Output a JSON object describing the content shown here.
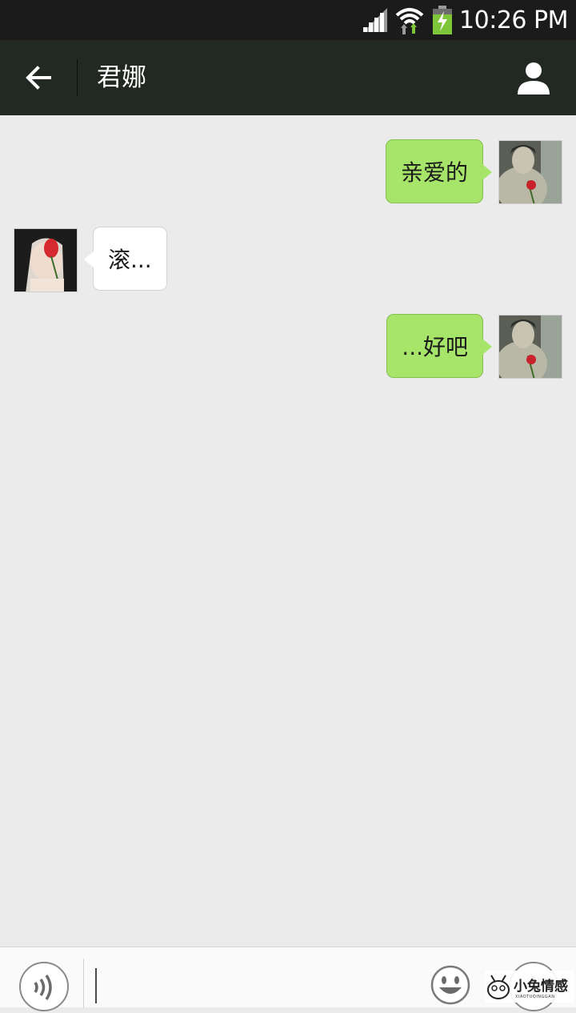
{
  "status_bar": {
    "time": "10:26 PM"
  },
  "header": {
    "title": "君娜"
  },
  "messages": [
    {
      "from": "me",
      "text": "亲爱的"
    },
    {
      "from": "other",
      "text": "滚..."
    },
    {
      "from": "me",
      "text": "...好吧"
    }
  ],
  "watermark": {
    "text": "小兔情感",
    "subtext": "XIAOTUQINGGAN"
  },
  "colors": {
    "status_bar": "#1b1b1b",
    "title_bar": "#212922",
    "background": "#ebebeb",
    "my_bubble": "#a7e46a",
    "other_bubble": "#ffffff"
  },
  "icons": {
    "back": "arrow-left-icon",
    "profile": "person-icon",
    "voice": "voice-icon",
    "emoji": "smiley-icon",
    "plus": "plus-icon"
  }
}
